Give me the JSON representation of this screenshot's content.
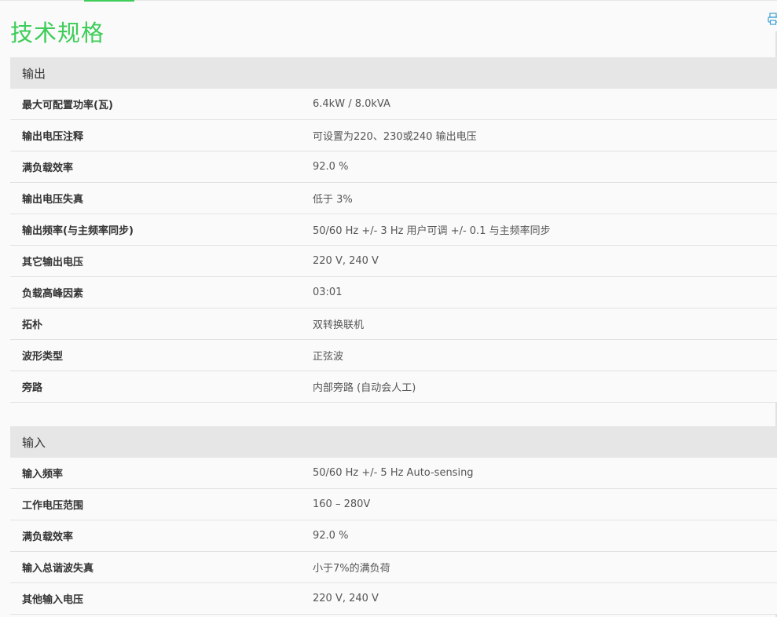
{
  "page_title": "技术规格",
  "accent_color": "#3dcd58",
  "print_icon": "printer-icon",
  "sections": [
    {
      "title": "输出",
      "rows": [
        {
          "label": "最大可配置功率(瓦)",
          "value": "6.4kW / 8.0kVA"
        },
        {
          "label": "输出电压注释",
          "value": "可设置为220、230或240 输出电压"
        },
        {
          "label": "满负载效率",
          "value": "92.0 %"
        },
        {
          "label": "输出电压失真",
          "value": "低于 3%"
        },
        {
          "label": "输出频率(与主频率同步)",
          "value": "50/60 Hz +/- 3 Hz 用户可调 +/- 0.1 与主频率同步"
        },
        {
          "label": "其它输出电压",
          "value": "220 V, 240 V"
        },
        {
          "label": "负载高峰因素",
          "value": "03:01"
        },
        {
          "label": "拓朴",
          "value": "双转换联机"
        },
        {
          "label": "波形类型",
          "value": "正弦波"
        },
        {
          "label": "旁路",
          "value": "内部旁路 (自动会人工)"
        }
      ]
    },
    {
      "title": "输入",
      "rows": [
        {
          "label": "输入频率",
          "value": "50/60 Hz +/- 5 Hz Auto-sensing"
        },
        {
          "label": "工作电压范围",
          "value": "160 – 280V"
        },
        {
          "label": "满负载效率",
          "value": "92.0 %"
        },
        {
          "label": "输入总谐波失真",
          "value": "小于7%的满负荷"
        },
        {
          "label": "其他输入电压",
          "value": "220 V, 240 V"
        }
      ]
    }
  ]
}
